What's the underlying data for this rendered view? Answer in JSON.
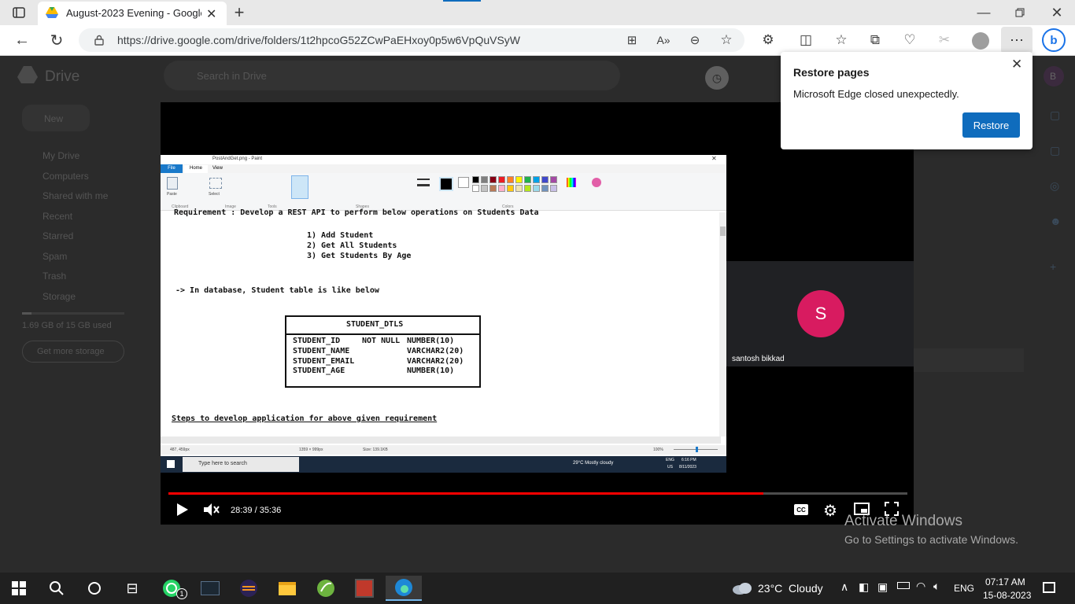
{
  "browser": {
    "tab_title": "August-2023 Evening - Google Dr",
    "url": "https://drive.google.com/drive/folders/1t2hpcoG52ZCwPaEHxoy0p5w6VpQuVSyW",
    "profile_initial": "B"
  },
  "drive": {
    "app_name": "Drive",
    "search_placeholder": "Search in Drive",
    "new_label": "New",
    "nav": [
      "My Drive",
      "Computers",
      "Shared with me",
      "Recent",
      "Starred",
      "Spam",
      "Trash",
      "Storage"
    ],
    "storage_text": "1.69 GB of 15 GB used",
    "get_storage": "Get more storage"
  },
  "paint": {
    "window_title": "PostAndGet.png - Paint",
    "tabs": [
      "File",
      "Home",
      "View"
    ],
    "groups": [
      "Clipboard",
      "Image",
      "Tools",
      "Shapes",
      "Colors"
    ],
    "buttons": [
      "Paste",
      "Cut",
      "Copy",
      "Select",
      "Crop",
      "Resize",
      "Rotate",
      "Brushes",
      "Outline",
      "Fill",
      "Size",
      "Color 1",
      "Color 2",
      "Edit colors",
      "Edit with Paint 3D"
    ],
    "status_pos": "487, 459px",
    "status_dims": "1359 × 999px",
    "status_size": "Size: 139.1KB",
    "zoom": "100%",
    "palette": [
      "#000000",
      "#7f7f7f",
      "#880015",
      "#ed1c24",
      "#ff7f27",
      "#fff200",
      "#22b14c",
      "#00a2e8",
      "#3f48cc",
      "#a349a4",
      "#ffffff",
      "#c3c3c3",
      "#b97a57",
      "#ffaec9",
      "#ffc90e",
      "#efe4b0",
      "#b5e61d",
      "#99d9ea",
      "#7092be",
      "#c8bfe7"
    ]
  },
  "doc": {
    "requirement": "Requirement : Develop a REST API to perform below operations on Students Data",
    "ops": [
      "1) Add Student",
      "2) Get All Students",
      "3) Get Students By Age"
    ],
    "db_line": "-> In database, Student table is like below",
    "table_name": "STUDENT_DTLS",
    "columns": [
      {
        "name": "STUDENT_ID",
        "constraint": "NOT NULL",
        "type": "NUMBER(10)"
      },
      {
        "name": "STUDENT_NAME",
        "constraint": "",
        "type": "VARCHAR2(20)"
      },
      {
        "name": "STUDENT_EMAIL",
        "constraint": "",
        "type": "VARCHAR2(20)"
      },
      {
        "name": "STUDENT_AGE",
        "constraint": "",
        "type": "NUMBER(10)"
      }
    ],
    "steps": "Steps to develop application for above given requirement"
  },
  "inner_taskbar": {
    "search": "Type here to search",
    "weather": "29°C  Mostly cloudy",
    "lang": "ENG",
    "region": "US",
    "time": "6:16 PM",
    "date": "8/11/2023"
  },
  "video": {
    "time": "28:39 / 35:36",
    "progress": 0.805,
    "participant_initial": "S",
    "participant_name": "santosh bikkad"
  },
  "popup": {
    "title": "Restore pages",
    "message": "Microsoft Edge closed unexpectedly.",
    "button": "Restore"
  },
  "watermark": {
    "line1": "Activate Windows",
    "line2": "Go to Settings to activate Windows."
  },
  "taskbar": {
    "weather": "23°C  Cloudy",
    "lang": "ENG",
    "time": "07:17 AM",
    "date": "15-08-2023",
    "whatsapp_badge": "1"
  },
  "colors": {
    "edge_blue": "#0f6cbd",
    "progress_red": "#ff0000",
    "avatar_red": "#d81b60",
    "drive_dim": "#2b2b2b"
  }
}
